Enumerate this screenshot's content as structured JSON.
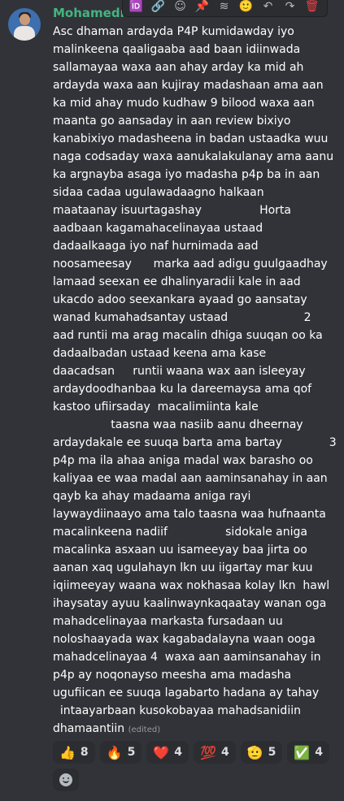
{
  "author": {
    "name": "Mohamedmo"
  },
  "toolbar": {
    "buttons": [
      {
        "icon": "message-id-icon",
        "glyph": "🆔"
      },
      {
        "icon": "link-icon",
        "glyph": "🔗"
      },
      {
        "icon": "add-reaction-icon",
        "glyph": "☺"
      },
      {
        "icon": "pin-icon",
        "glyph": "📌"
      },
      {
        "icon": "thread-icon",
        "glyph": "≋"
      },
      {
        "icon": "emoji-icon",
        "glyph": "🙂"
      },
      {
        "icon": "reply-icon",
        "glyph": "↶"
      },
      {
        "icon": "forward-icon",
        "glyph": "↷"
      },
      {
        "icon": "delete-icon",
        "glyph": "🗑"
      }
    ]
  },
  "message": {
    "lines": [
      "Asc dhaman ardayda P4P kumidawday iyo",
      "malinkeena qaaligaaba aad baan idiinwada",
      "sallamayaa waxa aan ahay arday ka mid ah",
      "ardayda waxa aan kujiray madashaan ama aan",
      "ka mid ahay mudo kudhaw 9 bilood waxa aan",
      "maanta go aansaday in aan review bixiyo",
      "kanabixiyo madasheena in badan ustaadka wuu",
      "naga codsaday waxa aanukalakulanay ama aanu",
      "ka argnayba asaga iyo madasha p4p ba in aan",
      "sidaa cadaa ugulawadaagno halkaan",
      "maataanay isuurtagashay                Horta",
      "aadbaan kagamahacelinayaa ustaad",
      "dadaalkaaga iyo naf hurnimada aad",
      "noosameesay      marka aad adigu guulgaadhay",
      "lamaad seexan ee dhalinyaradii kale in aad",
      "ukacdo adoo seexankara ayaad go aansatay",
      "wanad kumahadsantay ustaad                     2",
      "aad runtii ma arag macalin dhiga suuqan oo ka",
      "dadaalbadan ustaad keena ama kase",
      "daacadsan     runtii waana wax aan isleeyay",
      "ardaydoodhanbaa ku la dareemaysa ama qof",
      "kastoo ufiirsaday  macalimiinta kale",
      "                taasna waa nasiib aanu dheernay",
      "ardaydakale ee suuqa barta ama bartay             3",
      "p4p ma ila ahaa aniga madal wax barasho oo",
      "kaliyaa ee waa madal aan aaminsanahay in aan",
      "qayb ka ahay madaama aniga rayi",
      "laywaydiinaayo ama talo taasna waa hufnaanta",
      "macalinkeena nadiif                sidokale aniga",
      "macalinka asxaan uu isameeyay baa jirta oo",
      "aanan xaq ugulahayn lkn uu iigartay mar kuu",
      "iqiimeeyay waana wax nokhasaa kolay lkn  hawl",
      "ihaysatay ayuu kaalinwaynkaqaatay wanan oga",
      "mahadcelinayaa markasta fursadaan uu",
      "noloshaayada wax kagabadalayna waan ooga",
      "mahadcelinayaa 4  waxa aan aaminsanahay in",
      "p4p ay noqonayso meesha ama madasha",
      "ugufiican ee suuqa lagabarto hadana ay tahay",
      "  intaayarbaan kusokobayaa mahadsanidiin",
      "dhamaantiin"
    ],
    "edited_label": "(edited)"
  },
  "reactions": [
    {
      "emoji": "👍",
      "count": "8",
      "icon": "thumbs-up-icon"
    },
    {
      "emoji": "🔥",
      "count": "5",
      "icon": "fire-icon"
    },
    {
      "emoji": "❤️",
      "count": "4",
      "icon": "heart-icon"
    },
    {
      "emoji": "💯",
      "count": "4",
      "icon": "hundred-points-icon"
    },
    {
      "emoji": "🫡",
      "count": "5",
      "icon": "saluting-face-icon"
    },
    {
      "emoji": "✅",
      "count": "4",
      "icon": "check-mark-icon"
    }
  ]
}
